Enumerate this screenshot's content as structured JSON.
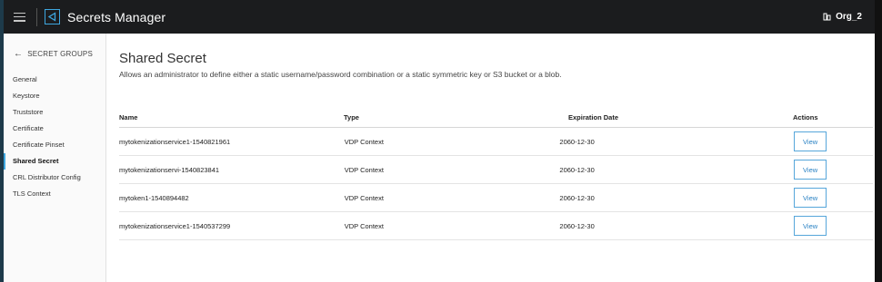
{
  "header": {
    "title": "Secrets Manager",
    "org": "Org_2",
    "icons": {
      "menu": "hamburger-icon",
      "logo": "app-logo-icon",
      "org": "org-icon"
    }
  },
  "sidebar": {
    "back_label": "SECRET GROUPS",
    "items": [
      {
        "label": "General",
        "active": false
      },
      {
        "label": "Keystore",
        "active": false
      },
      {
        "label": "Truststore",
        "active": false
      },
      {
        "label": "Certificate",
        "active": false
      },
      {
        "label": "Certificate Pinset",
        "active": false
      },
      {
        "label": "Shared Secret",
        "active": true
      },
      {
        "label": "CRL Distributor Config",
        "active": false
      },
      {
        "label": "TLS Context",
        "active": false
      }
    ]
  },
  "main": {
    "title": "Shared Secret",
    "description": "Allows an administrator to define either a static username/password combination or a static symmetric key or S3 bucket or a blob.",
    "table": {
      "headers": {
        "name": "Name",
        "type": "Type",
        "expiration": "Expiration Date",
        "actions": "Actions"
      },
      "rows": [
        {
          "name": "mytokenizationservice1-1540821961",
          "type": "VDP Context",
          "expiration": "2060-12-30",
          "action": "View"
        },
        {
          "name": "mytokenizationservi-1540823841",
          "type": "VDP Context",
          "expiration": "2060-12-30",
          "action": "View"
        },
        {
          "name": "mytoken1-1540894482",
          "type": "VDP Context",
          "expiration": "2060-12-30",
          "action": "View"
        },
        {
          "name": "mytokenizationservice1-1540537299",
          "type": "VDP Context",
          "expiration": "2060-12-30",
          "action": "View"
        }
      ]
    }
  },
  "colors": {
    "topbar": "#1b1c1e",
    "accent": "#3ea7e0",
    "button_border": "#56a6da"
  }
}
